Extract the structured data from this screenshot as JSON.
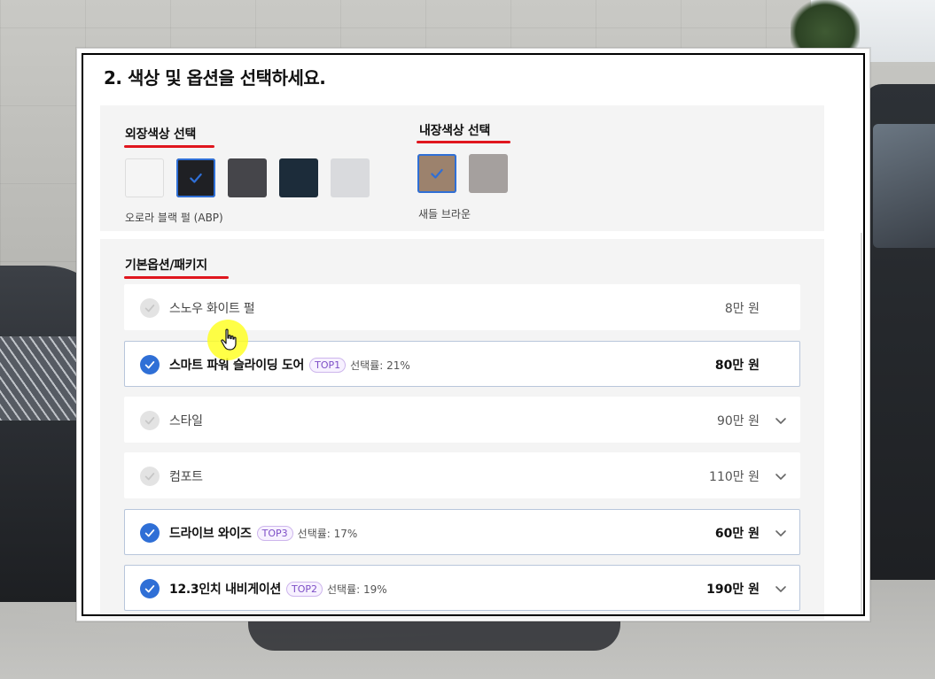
{
  "step": {
    "title": "2. 색상 및 옵션을 선택하세요."
  },
  "exterior": {
    "label": "외장색상 선택",
    "swatches": [
      {
        "color": "#f5f5f5",
        "selected": false
      },
      {
        "color": "#1f2024",
        "selected": true
      },
      {
        "color": "#45454a",
        "selected": false
      },
      {
        "color": "#1c2c3a",
        "selected": false
      },
      {
        "color": "#d9dadd",
        "selected": false
      }
    ],
    "selected_name": "오로라 블랙 펄 (ABP)"
  },
  "interior": {
    "label": "내장색상 선택",
    "swatches": [
      {
        "color": "#9c826d",
        "selected": true
      },
      {
        "color": "#a5a09e",
        "selected": false
      }
    ],
    "selected_name": "새들 브라운"
  },
  "options": {
    "label": "기본옵션/패키지",
    "items": [
      {
        "name": "스노우 화이트 펄",
        "price_amount": "8",
        "price_unit": "만 원",
        "selected": false,
        "expandable": false
      },
      {
        "name": "스마트 파워 슬라이딩 도어",
        "badge": "TOP1",
        "rate": "선택률: 21%",
        "price_amount": "80",
        "price_unit": "만 원",
        "selected": true,
        "expandable": false
      },
      {
        "name": "스타일",
        "price_amount": "90",
        "price_unit": "만 원",
        "selected": false,
        "expandable": true
      },
      {
        "name": "컴포트",
        "price_amount": "110",
        "price_unit": "만 원",
        "selected": false,
        "expandable": true
      },
      {
        "name": "드라이브 와이즈",
        "badge": "TOP3",
        "rate": "선택률: 17%",
        "price_amount": "60",
        "price_unit": "만 원",
        "selected": true,
        "expandable": true
      },
      {
        "name": "12.3인치 내비게이션",
        "badge": "TOP2",
        "rate": "선택률: 19%",
        "price_amount": "190",
        "price_unit": "만 원",
        "selected": true,
        "expandable": true
      }
    ]
  },
  "colors": {
    "accent_blue": "#2f6fd6",
    "annotation_red": "#e0161e",
    "badge_purple": "#7d4ec6"
  },
  "icons": [
    "check-icon",
    "chevron-down-icon",
    "hand-pointer-icon"
  ]
}
